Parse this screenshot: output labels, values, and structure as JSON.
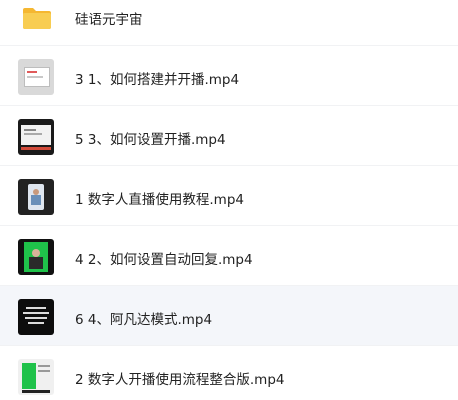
{
  "files": [
    {
      "name": "硅语元宇宙",
      "icon": "folder-icon",
      "selected": false
    },
    {
      "name": "3 1、如何搭建并开播.mp4",
      "icon": "video-thumbnail-icon",
      "selected": false
    },
    {
      "name": "5 3、如何设置开播.mp4",
      "icon": "video-thumbnail-icon",
      "selected": false
    },
    {
      "name": "1 数字人直播使用教程.mp4",
      "icon": "video-thumbnail-icon",
      "selected": false
    },
    {
      "name": "4 2、如何设置自动回复.mp4",
      "icon": "video-thumbnail-icon",
      "selected": false
    },
    {
      "name": "6 4、阿凡达模式.mp4",
      "icon": "video-thumbnail-icon",
      "selected": true
    },
    {
      "name": "2 数字人开播使用流程整合版.mp4",
      "icon": "video-thumbnail-icon",
      "selected": false
    }
  ],
  "colors": {
    "folder": "#f6c443",
    "green_screen": "#1fc24a",
    "selected_row": "#f4f6fa"
  }
}
